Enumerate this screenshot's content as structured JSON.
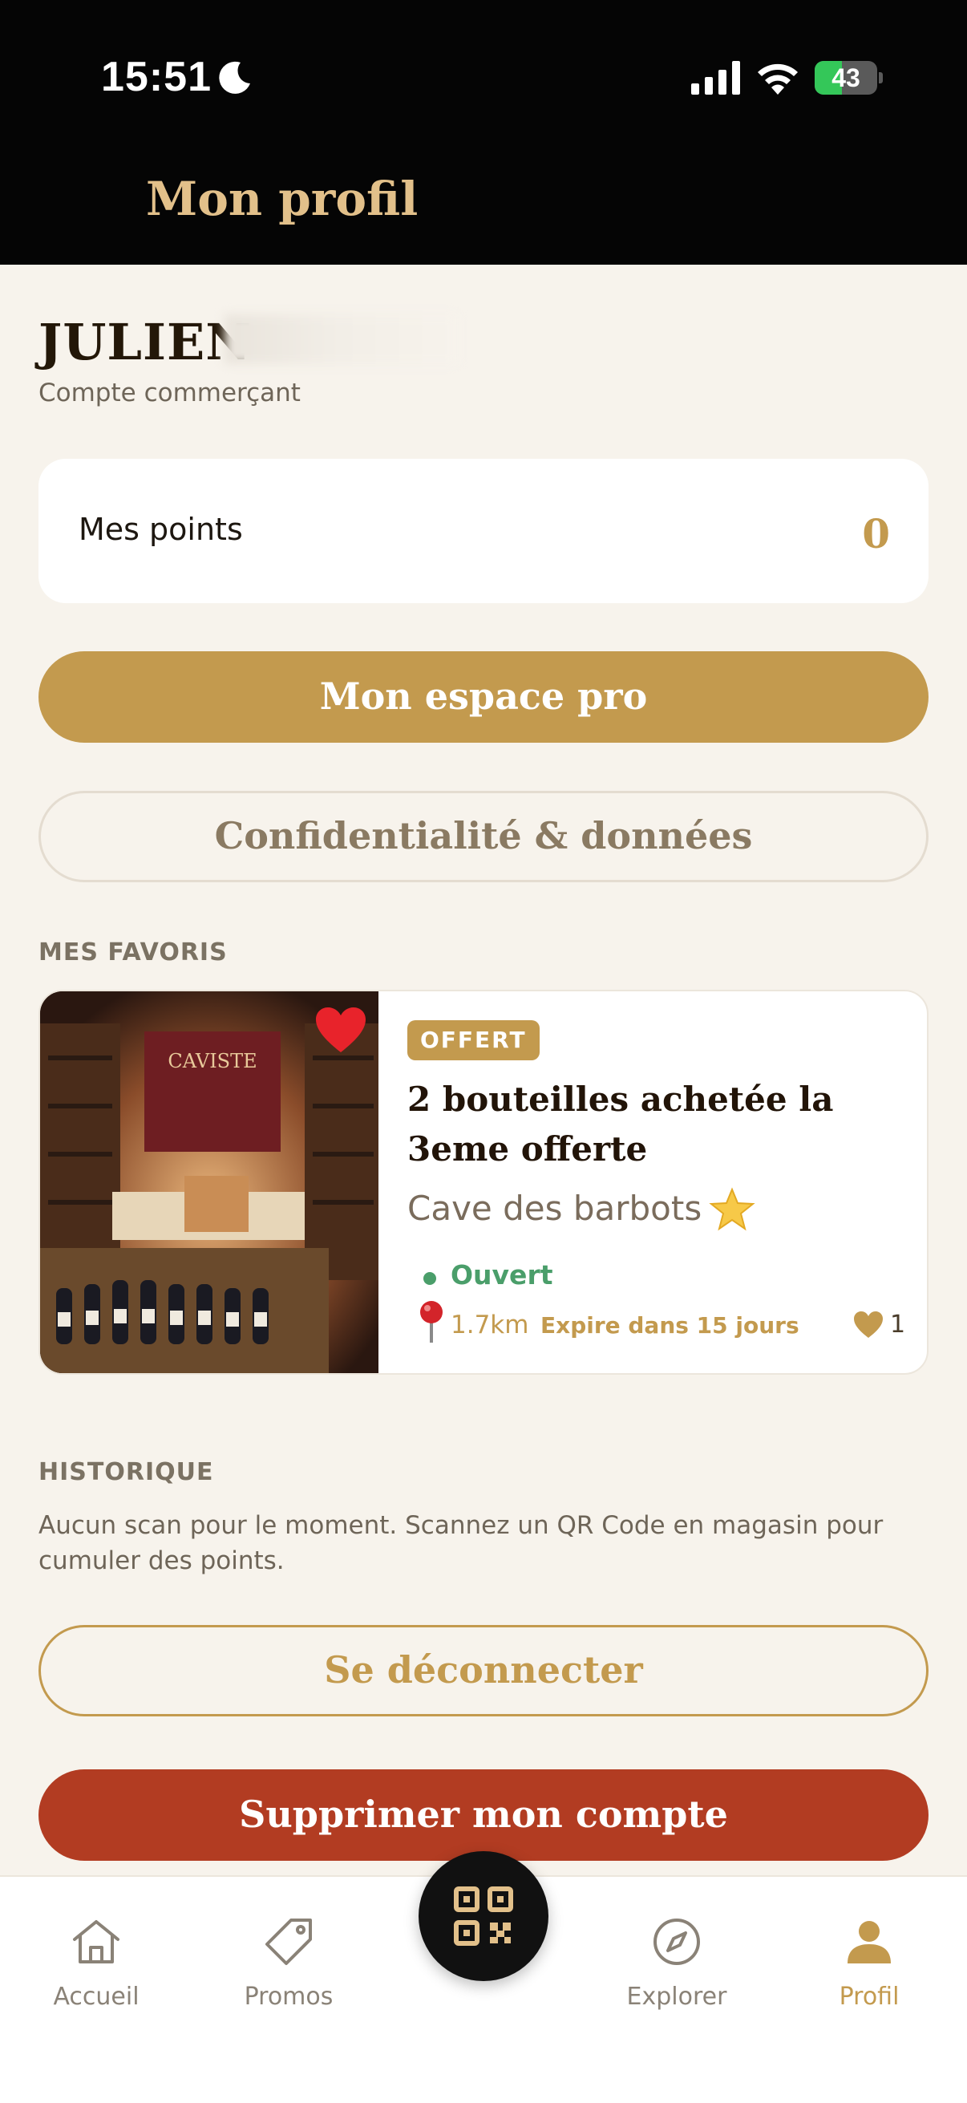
{
  "status_bar": {
    "time": "15:51",
    "battery": "43",
    "battery_level": 0.43
  },
  "header": {
    "title": "Mon profil"
  },
  "profile": {
    "name": "JULIEN",
    "account_type": "Compte commerçant"
  },
  "points": {
    "label": "Mes points",
    "value": "0"
  },
  "buttons": {
    "pro_space": "Mon espace pro",
    "privacy": "Confidentialité & données",
    "logout": "Se déconnecter",
    "delete_account": "Supprimer mon compte"
  },
  "favorites": {
    "section_title": "MES FAVORIS",
    "items": [
      {
        "badge": "OFFERT",
        "title": "2 bouteilles achetée la 3eme offerte",
        "shop": "Cave des barbots",
        "status": "Ouvert",
        "distance": "1.7km",
        "expires": "Expire dans 15 jours",
        "likes": "1",
        "image_sign": "CAVISTE"
      }
    ]
  },
  "history": {
    "section_title": "HISTORIQUE",
    "empty_text": "Aucun scan pour le moment. Scannez un QR Code en magasin pour cumuler des points."
  },
  "nav": {
    "home": "Accueil",
    "promos": "Promos",
    "explore": "Explorer",
    "profile": "Profil",
    "active": "profile"
  },
  "colors": {
    "gold": "#c39a4e",
    "dark": "#050505",
    "background": "#f7f3ec",
    "danger": "#b23c22",
    "open": "#4a9e6a"
  }
}
